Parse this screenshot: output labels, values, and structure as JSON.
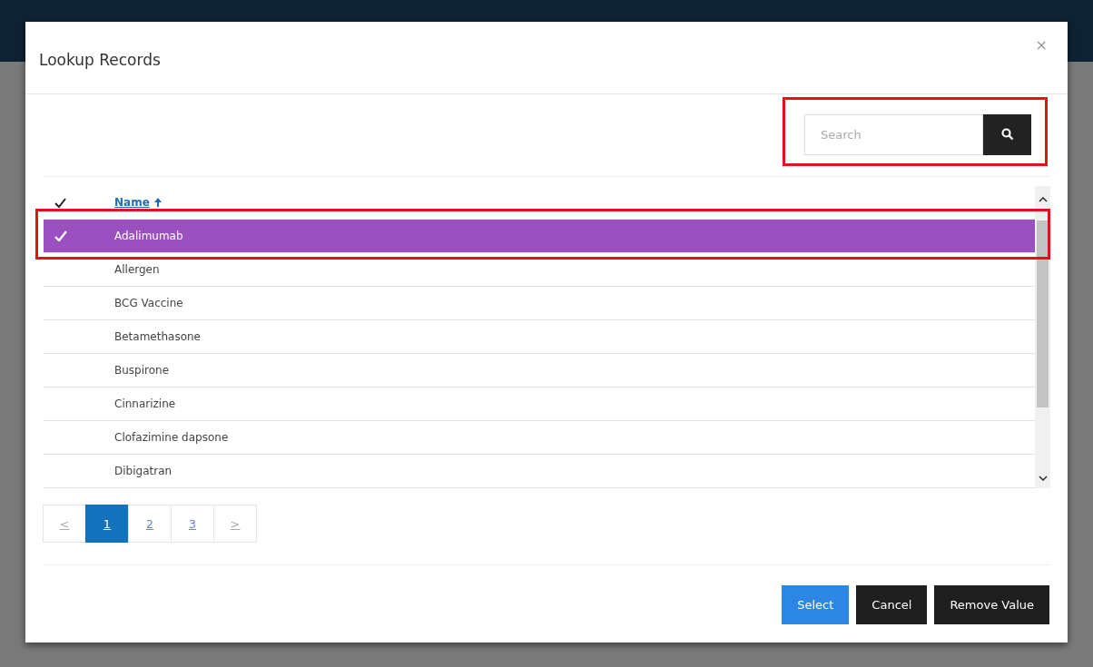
{
  "dialog": {
    "title": "Lookup Records",
    "close": "×"
  },
  "search": {
    "placeholder": "Search",
    "highlighted": true
  },
  "table": {
    "columns": [
      {
        "label": "Name",
        "sort_ascending": true
      }
    ],
    "rows": [
      {
        "name": "Adalimumab",
        "selected": true,
        "highlighted": true
      },
      {
        "name": "Allergen",
        "selected": false,
        "highlighted": false
      },
      {
        "name": "BCG Vaccine",
        "selected": false,
        "highlighted": false
      },
      {
        "name": "Betamethasone",
        "selected": false,
        "highlighted": false
      },
      {
        "name": "Buspirone",
        "selected": false,
        "highlighted": false
      },
      {
        "name": "Cinnarizine",
        "selected": false,
        "highlighted": false
      },
      {
        "name": "Clofazimine dapsone",
        "selected": false,
        "highlighted": false
      },
      {
        "name": "Dibigatran",
        "selected": false,
        "highlighted": false
      }
    ]
  },
  "pagination": [
    {
      "label": "<",
      "selected": false
    },
    {
      "label": "1",
      "selected": true
    },
    {
      "label": "2",
      "selected": false
    },
    {
      "label": "3",
      "selected": false
    },
    {
      "label": ">",
      "selected": false
    }
  ],
  "buttons": [
    {
      "label": "Select",
      "kind": "primary"
    },
    {
      "label": "Cancel",
      "kind": "dark"
    },
    {
      "label": "Remove Value",
      "kind": "dark"
    }
  ]
}
